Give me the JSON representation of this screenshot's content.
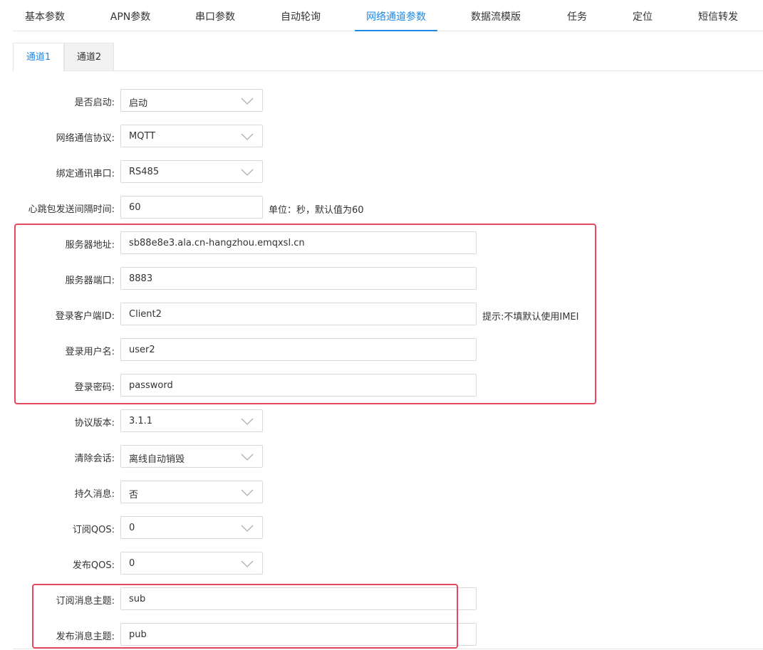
{
  "top_tabs": [
    "基本参数",
    "APN参数",
    "串口参数",
    "自动轮询",
    "网络通道参数",
    "数据流模版",
    "任务",
    "定位",
    "短信转发"
  ],
  "active_top_tab": "网络通道参数",
  "sub_tabs": [
    "通道1",
    "通道2"
  ],
  "active_sub_tab": "通道1",
  "form": {
    "enable": {
      "label": "是否启动:",
      "value": "启动"
    },
    "protocol": {
      "label": "网络通信协议:",
      "value": "MQTT"
    },
    "serial": {
      "label": "绑定通讯串口:",
      "value": "RS485"
    },
    "heartbeat": {
      "label": "心跳包发送间隔时间:",
      "value": "60",
      "hint": "单位：秒，默认值为60"
    },
    "server_addr": {
      "label": "服务器地址:",
      "value": "sb88e8e3.ala.cn-hangzhou.emqxsl.cn"
    },
    "server_port": {
      "label": "服务器端口:",
      "value": "8883"
    },
    "client_id": {
      "label": "登录客户端ID:",
      "value": "Client2",
      "hint": "提示:不填默认使用IMEI"
    },
    "username": {
      "label": "登录用户名:",
      "value": "user2"
    },
    "password": {
      "label": "登录密码:",
      "value": "password"
    },
    "version": {
      "label": "协议版本:",
      "value": "3.1.1"
    },
    "clean_session": {
      "label": "清除会话:",
      "value": "离线自动销毁"
    },
    "retain": {
      "label": "持久消息:",
      "value": "否"
    },
    "sub_qos": {
      "label": "订阅QOS:",
      "value": "0"
    },
    "pub_qos": {
      "label": "发布QOS:",
      "value": "0"
    },
    "sub_topic": {
      "label": "订阅消息主题:",
      "value": "sub"
    },
    "pub_topic": {
      "label": "发布消息主题:",
      "value": "pub"
    }
  },
  "colors": {
    "accent": "#1e88e5",
    "highlight_box": "#e5475d",
    "border": "#d9d9d9"
  }
}
